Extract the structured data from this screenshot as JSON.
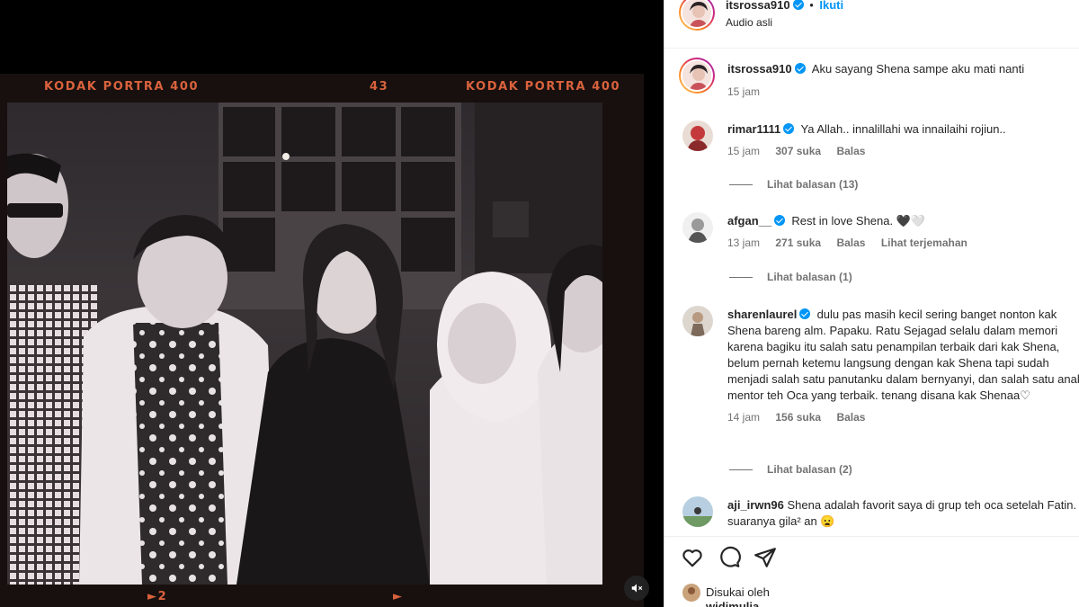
{
  "media": {
    "film_brand_left": "KODAK PORTRA 400",
    "film_frame_number": "43",
    "film_brand_right": "KODAK PORTRA 400",
    "frame_marker_left": "►2",
    "frame_marker_right": "►",
    "mute_icon": "speaker-muted-icon"
  },
  "post": {
    "author": "itsrossa910",
    "separator": "•",
    "follow_label": "Ikuti",
    "audio_label": "Audio asli",
    "caption": "Aku sayang Shena sampe aku mati nanti",
    "caption_time": "15 jam"
  },
  "comments": [
    {
      "username": "rimar1111",
      "text": "Ya Allah.. innalillahi wa innailaihi rojiun..",
      "time": "15 jam",
      "likes": "307 suka",
      "reply_label": "Balas",
      "view_replies": "Lihat balasan (13)"
    },
    {
      "username": "afgan__",
      "text": "Rest in love Shena. 🖤🤍",
      "time": "13 jam",
      "likes": "271 suka",
      "reply_label": "Balas",
      "translate_label": "Lihat terjemahan",
      "view_replies": "Lihat balasan (1)"
    },
    {
      "username": "sharenlaurel",
      "text": "dulu pas masih kecil sering banget nonton kak Shena bareng alm. Papaku. Ratu Sejagad selalu dalam memori karena bagiku itu salah satu penampilan terbaik dari kak Shena, belum pernah ketemu langsung dengan kak Shena tapi sudah menjadi salah satu panutanku dalam bernyanyi, dan salah satu anak mentor teh Oca yang terbaik. tenang disana kak Shenaa♡",
      "time": "14 jam",
      "likes": "156 suka",
      "reply_label": "Balas",
      "view_replies": "Lihat balasan (2)"
    },
    {
      "username": "aji_irwn96",
      "text": "Shena adalah favorit saya di grup teh oca setelah Fatin. suaranya gila² an 😦"
    }
  ],
  "actions": {
    "like_icon": "heart-icon",
    "comment_icon": "comment-icon",
    "share_icon": "send-icon",
    "liked_by_label": "Disukai oleh",
    "liked_by_user": "widimulia"
  },
  "colors": {
    "film_text": "#d9623d",
    "verified": "#0095f6",
    "text_primary": "#262626",
    "text_secondary": "#737373",
    "follow": "#0095f6"
  }
}
